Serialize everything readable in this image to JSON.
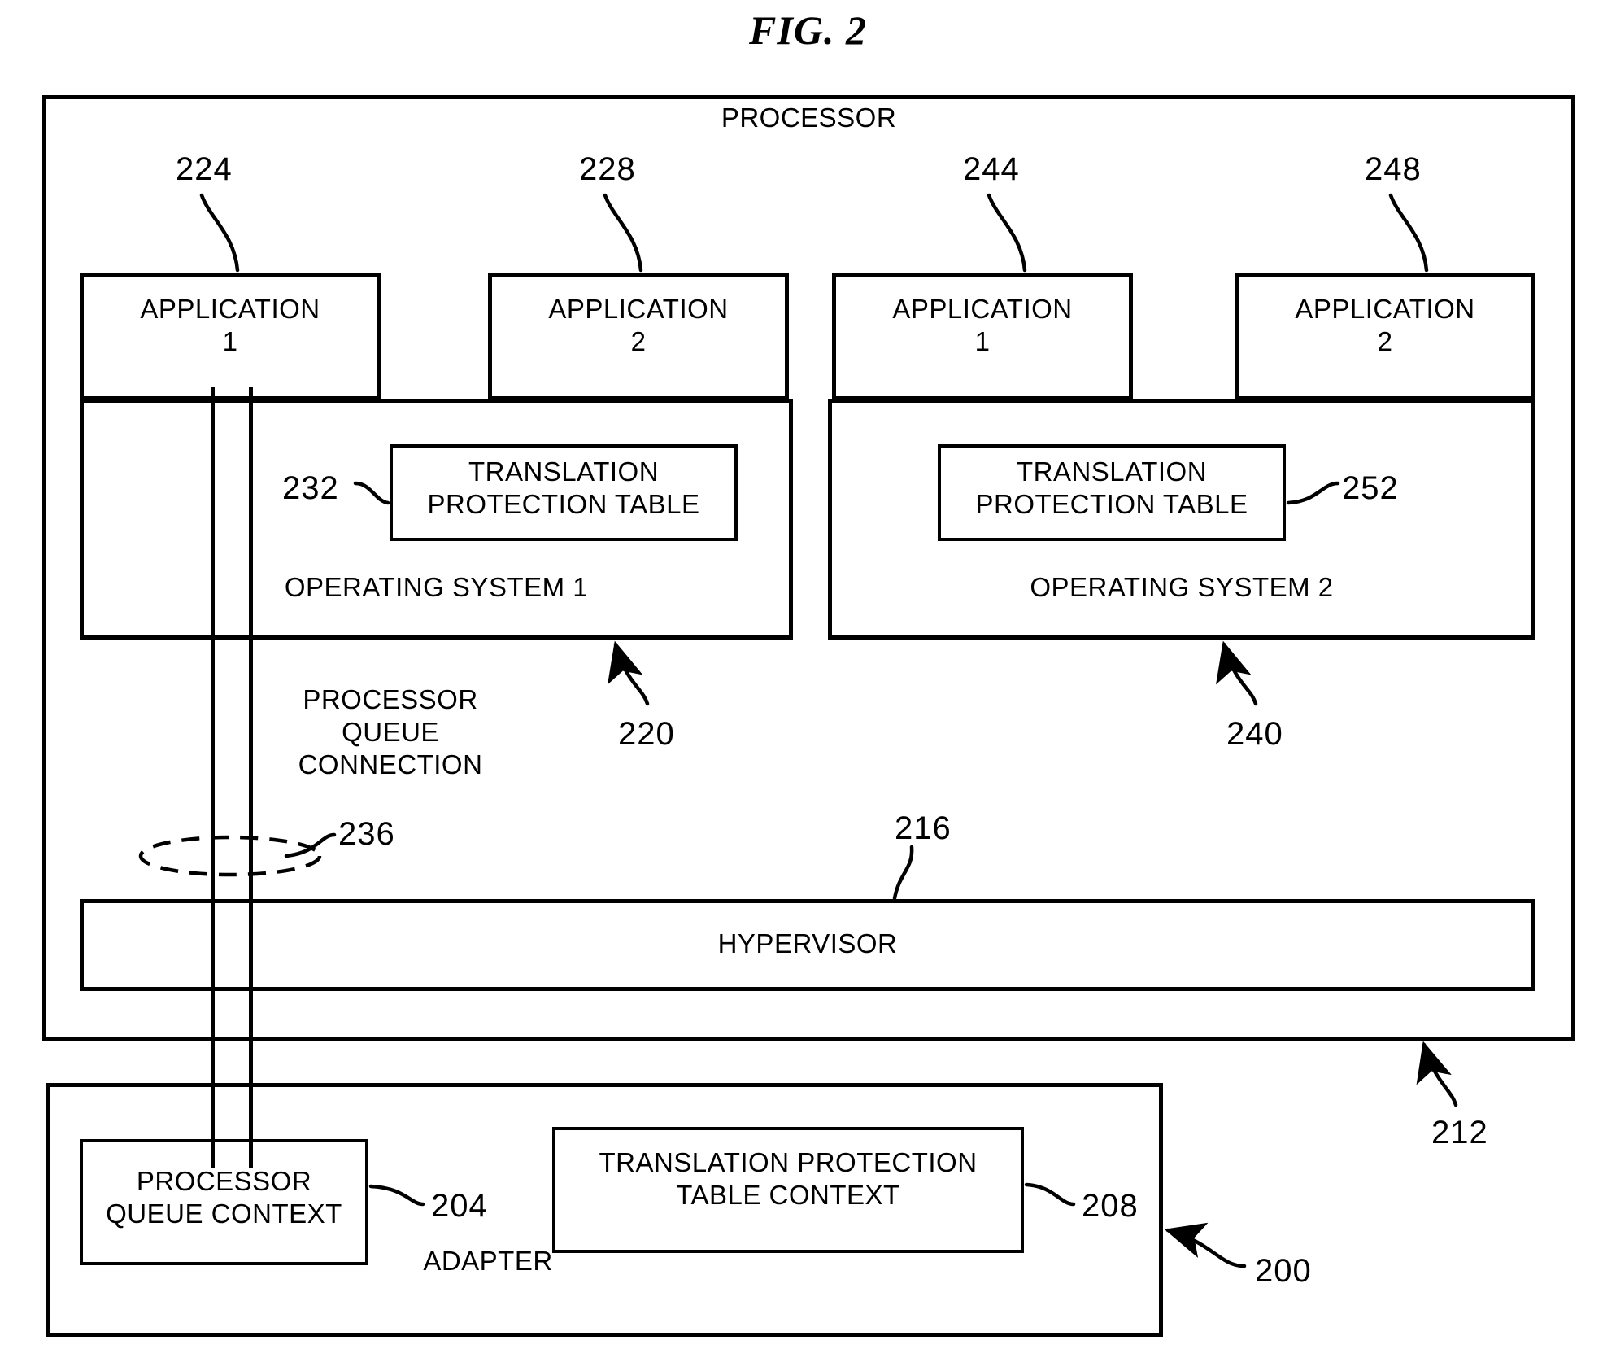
{
  "figure": {
    "title": "FIG. 2"
  },
  "processor": {
    "label": "PROCESSOR",
    "ref": "212"
  },
  "applications": [
    {
      "label": "APPLICATION\n1",
      "ref": "224"
    },
    {
      "label": "APPLICATION\n2",
      "ref": "228"
    },
    {
      "label": "APPLICATION\n1",
      "ref": "244"
    },
    {
      "label": "APPLICATION\n2",
      "ref": "248"
    }
  ],
  "operating_systems": [
    {
      "label": "OPERATING SYSTEM 1",
      "ref": "220",
      "table": {
        "label": "TRANSLATION\nPROTECTION TABLE",
        "ref": "232"
      }
    },
    {
      "label": "OPERATING SYSTEM 2",
      "ref": "240",
      "table": {
        "label": "TRANSLATION\nPROTECTION TABLE",
        "ref": "252"
      }
    }
  ],
  "queue_connection": {
    "label": "PROCESSOR\nQUEUE\nCONNECTION",
    "ref": "236"
  },
  "hypervisor": {
    "label": "HYPERVISOR",
    "ref": "216"
  },
  "adapter": {
    "label": "ADAPTER",
    "ref": "200",
    "contexts": [
      {
        "label": "PROCESSOR\nQUEUE CONTEXT",
        "ref": "204"
      },
      {
        "label": "TRANSLATION PROTECTION\nTABLE CONTEXT",
        "ref": "208"
      }
    ]
  },
  "colors": {
    "ink": "#000000",
    "paper": "#ffffff"
  }
}
